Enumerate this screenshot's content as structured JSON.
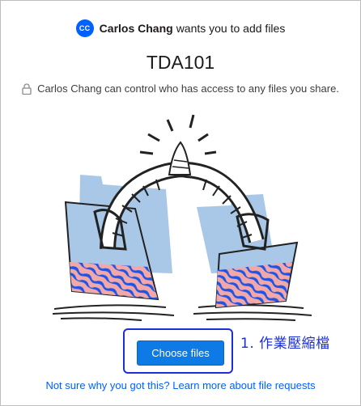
{
  "requester": {
    "initials": "CC",
    "name": "Carlos Chang",
    "message": "wants you to add files"
  },
  "request_title": "TDA101",
  "access_notice": "Carlos Chang can control who has access to any files you share.",
  "upload": {
    "button_label": "Choose files"
  },
  "annotation": {
    "text": "1. 作業壓縮檔"
  },
  "help_link": "Not sure why you got this? Learn more about file requests",
  "colors": {
    "accent": "#0061fe",
    "button": "#0e7ae6",
    "annotation": "#1a2fd6"
  }
}
